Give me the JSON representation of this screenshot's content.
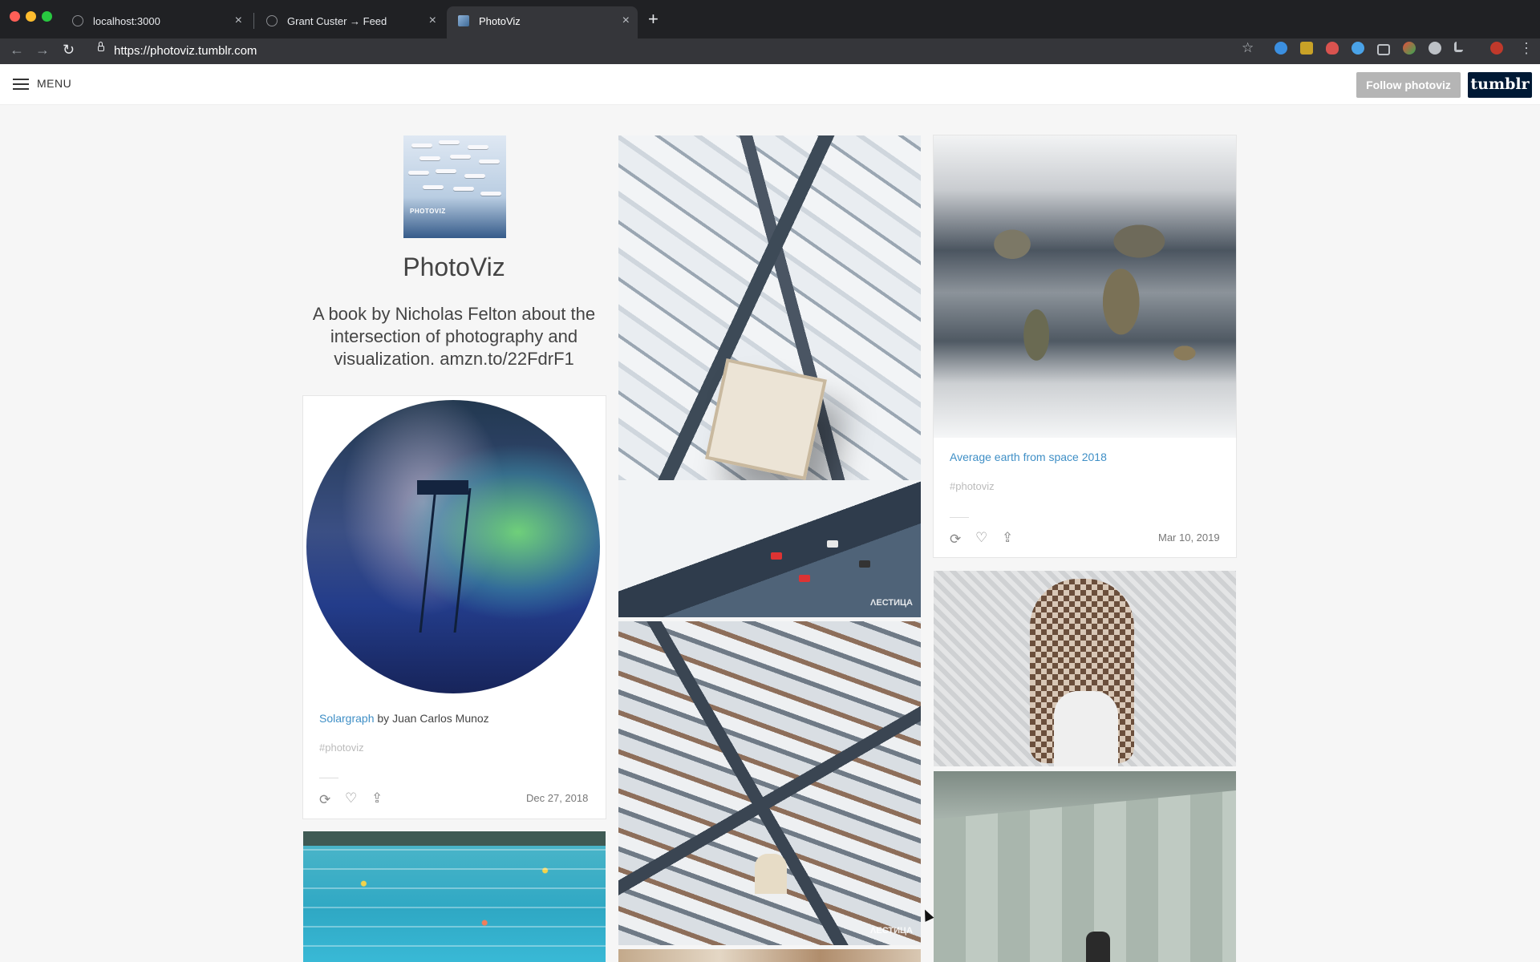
{
  "browser": {
    "tabs": [
      {
        "title": "localhost:3000",
        "active": false
      },
      {
        "title": "Grant Custer → Feed",
        "active": false
      },
      {
        "title": "PhotoViz",
        "active": true
      }
    ],
    "new_tab": "+",
    "close_glyph": "×",
    "url": "https://photoviz.tumblr.com",
    "nav": {
      "back": "←",
      "forward": "→",
      "reload": "↻"
    },
    "bookmark_icon": "☆",
    "menu_icon": "⋮"
  },
  "header": {
    "menu_label": "MENU",
    "follow_label": "Follow photoviz",
    "logo_text": "tumblr"
  },
  "profile": {
    "title": "PhotoViz",
    "description": "A book by Nicholas Felton about the intersection of photography and visualization. amzn.to/22FdrF1",
    "avatar_text": "PHOTOVIZ"
  },
  "posts": [
    {
      "link_text": "Solargraph",
      "byline": " by Juan Carlos Munoz",
      "tag": "#photoviz",
      "date": "Dec 27, 2018"
    },
    {
      "link_text": "Average earth from space 2018",
      "byline": "",
      "tag": "#photoviz",
      "date": "Mar 10, 2019"
    }
  ],
  "actions": {
    "reblog": "⟳",
    "like": "♡",
    "share": "⇪"
  },
  "watermark": "ΛΕСТИЦА"
}
